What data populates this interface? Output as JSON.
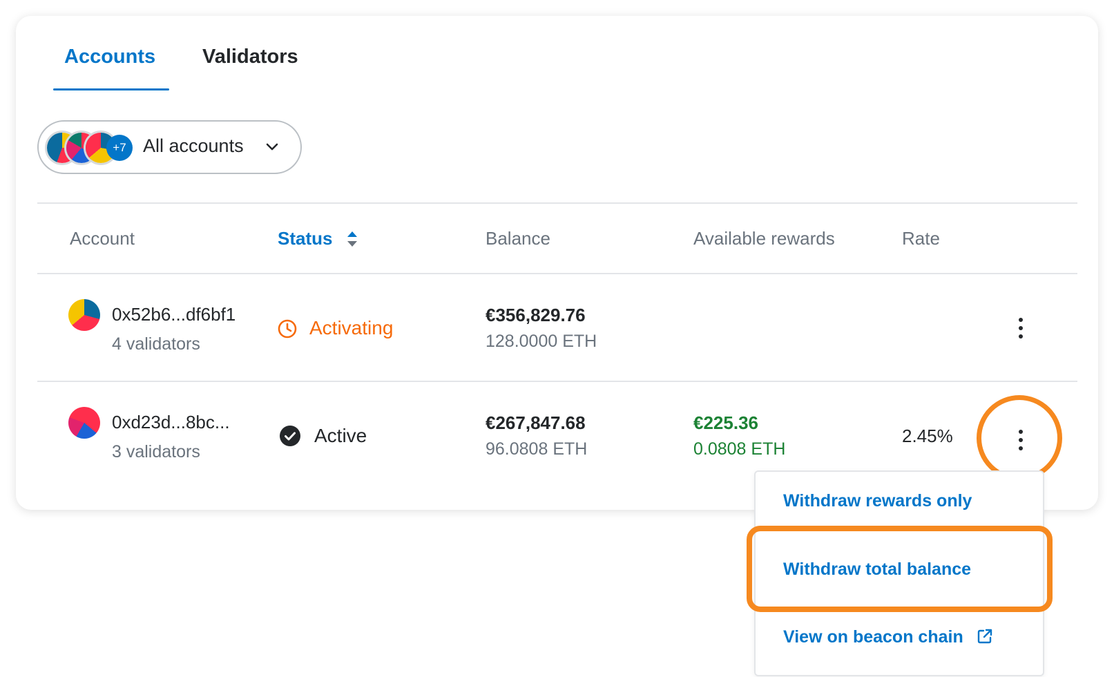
{
  "tabs": [
    {
      "label": "Accounts",
      "active": true
    },
    {
      "label": "Validators",
      "active": false
    }
  ],
  "account_picker": {
    "label": "All accounts",
    "more_count": "+7"
  },
  "table": {
    "headers": {
      "account": "Account",
      "status": "Status",
      "balance": "Balance",
      "rewards": "Available rewards",
      "rate": "Rate"
    },
    "rows": [
      {
        "address": "0x52b6...df6bf1",
        "validators": "4 validators",
        "status": "Activating",
        "balance_fiat": "€356,829.76",
        "balance_eth": "128.0000 ETH",
        "rewards_fiat": "",
        "rewards_eth": "",
        "rate": ""
      },
      {
        "address": "0xd23d...8bc...",
        "validators": "3 validators",
        "status": "Active",
        "balance_fiat": "€267,847.68",
        "balance_eth": "96.0808 ETH",
        "rewards_fiat": "€225.36",
        "rewards_eth": "0.0808 ETH",
        "rate": "2.45%"
      }
    ]
  },
  "row_menu": {
    "items": [
      {
        "label": "Withdraw rewards only"
      },
      {
        "label": "Withdraw total balance"
      },
      {
        "label": "View on beacon chain"
      }
    ]
  },
  "colors": {
    "accent": "#0376c9",
    "activating": "#f66a0a",
    "positive": "#1c8234",
    "highlight": "#f6891f"
  },
  "icons": {
    "status_activating": "clock-icon",
    "status_active": "check-circle-icon",
    "sort": "sort-icon",
    "dropdown": "chevron-down-icon",
    "row_actions": "more-vertical-icon",
    "external_link": "external-link-icon"
  }
}
